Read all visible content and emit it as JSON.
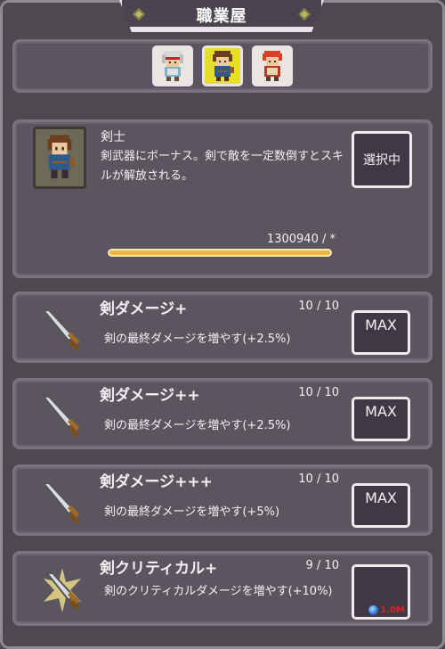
{
  "header": {
    "title": "職業屋"
  },
  "jobs": [
    {
      "name": "job-1",
      "active": false
    },
    {
      "name": "job-2",
      "active": true
    },
    {
      "name": "job-3",
      "active": false
    }
  ],
  "job_info": {
    "name": "剣士",
    "description": "剣武器にボーナス。剣で敵を一定数倒すとスキルが解放される。",
    "select_label": "選択中",
    "exp_text": "1300940 / *",
    "exp_progress": 1.0
  },
  "skills": [
    {
      "name": "剣ダメージ+",
      "level": "10 / 10",
      "description": "剣の最終ダメージを増やす(+2.5%)",
      "button": "MAX"
    },
    {
      "name": "剣ダメージ++",
      "level": "10 / 10",
      "description": "剣の最終ダメージを増やす(+2.5%)",
      "button": "MAX"
    },
    {
      "name": "剣ダメージ+++",
      "level": "10 / 10",
      "description": "剣の最終ダメージを増やす(+5%)",
      "button": "MAX"
    },
    {
      "name": "剣クリティカル+",
      "level": "9 / 10",
      "description": "剣のクリティカルダメージを増やす(+10%)",
      "button": "",
      "cost": "1.0M"
    }
  ],
  "colors": {
    "accent": "#e6dd2c",
    "exp_bar": "#f1b93a",
    "cost": "#e02020"
  }
}
